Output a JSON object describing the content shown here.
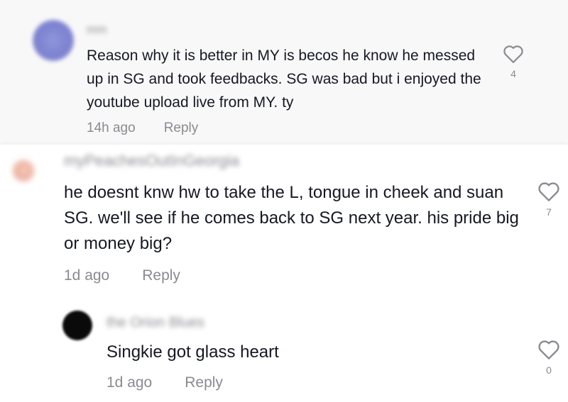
{
  "comments": [
    {
      "username": "mm",
      "text": "Reason why it is better in MY is becos he know he messed up in SG and took feedbacks. SG was bad but i enjoyed the youtube upload live from MY. ty",
      "time": "14h ago",
      "reply_label": "Reply",
      "likes": "4",
      "like_icon": "heart-outline-icon",
      "avatar_color": "#8a90d8"
    },
    {
      "username": "myPeachesOutInGeorgia",
      "text": "he doesnt knw hw to take the L, tongue in cheek and suan SG. we'll see if he comes back to SG next year. his pride big or money big?",
      "time": "1d ago",
      "reply_label": "Reply",
      "likes": "7",
      "like_icon": "heart-outline-icon",
      "avatar_color": "#f0c2b4"
    },
    {
      "username": "the Orion Blues",
      "text": "Singkie got glass heart",
      "time": "1d ago",
      "reply_label": "Reply",
      "likes": "0",
      "like_icon": "heart-outline-icon",
      "avatar_color": "#0a0a0a"
    }
  ]
}
